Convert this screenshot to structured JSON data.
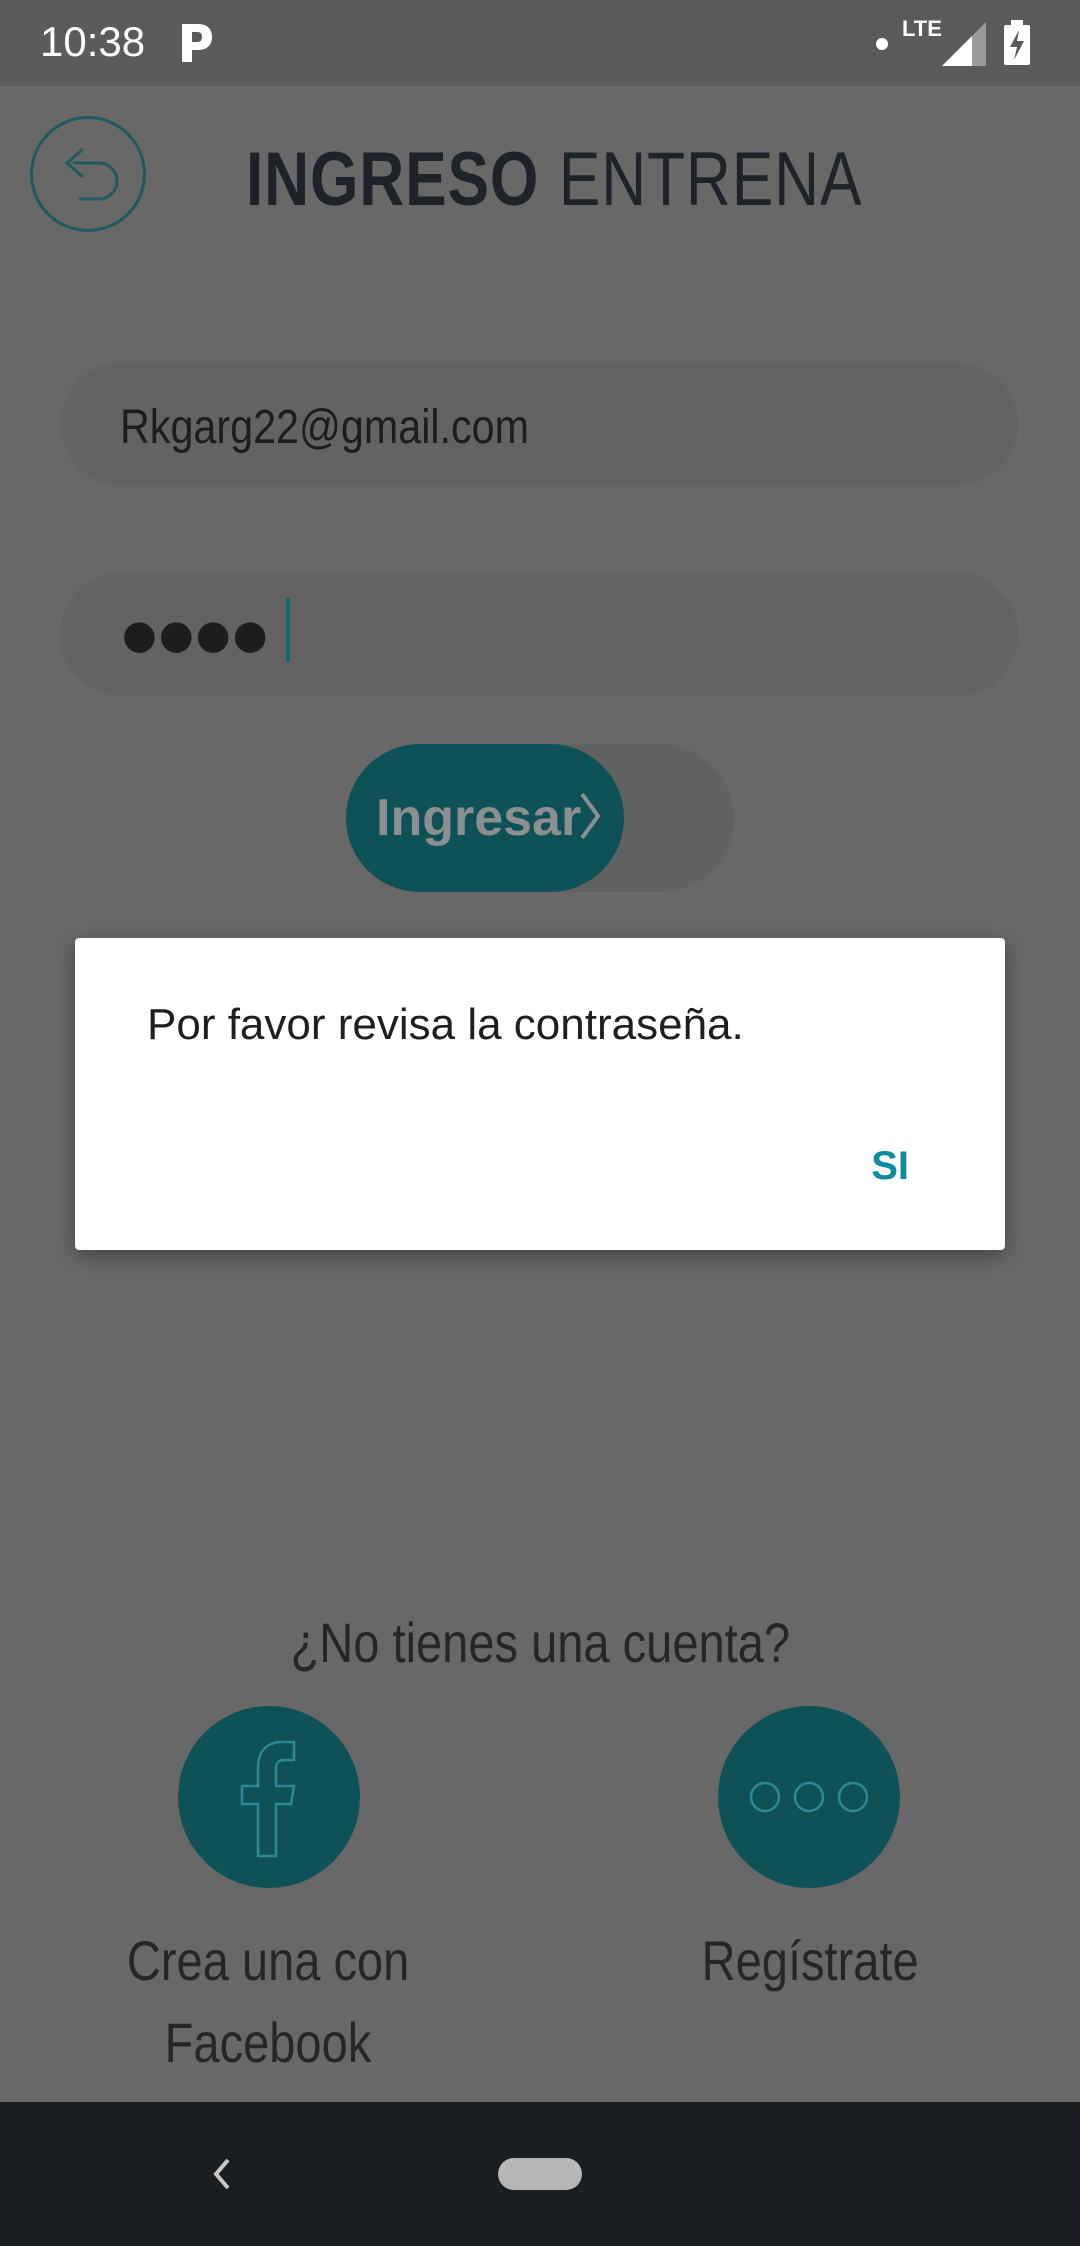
{
  "status_bar": {
    "time": "10:38",
    "network": "LTE",
    "icons": [
      "parking-app-icon",
      "dot-icon",
      "signal-icon",
      "battery-charging-icon"
    ]
  },
  "header": {
    "back_icon": "return-arrow-icon",
    "title_bold": "INGRESO",
    "title_light": "ENTRENA"
  },
  "form": {
    "email_value": "Rkgarg22@gmail.com",
    "password_dots": "●●●●",
    "submit_label": "Ingresar",
    "submit_icon": "chevron-right-icon"
  },
  "signup": {
    "prompt": "¿No tienes una cuenta?",
    "facebook_icon": "facebook-icon",
    "facebook_label_line1": "Crea una con",
    "facebook_label_line2": "Facebook",
    "register_icon": "more-dots-icon",
    "register_label": "Regístrate"
  },
  "dialog": {
    "message": "Por favor revisa la contraseña.",
    "ok_label": "SI"
  },
  "nav_bar": {
    "back_icon": "nav-back-icon",
    "home_icon": "home-pill-icon"
  },
  "colors": {
    "teal_dark": "#0e5157",
    "dialog_accent": "#0d8ca0",
    "scrim_background": "#686868"
  }
}
